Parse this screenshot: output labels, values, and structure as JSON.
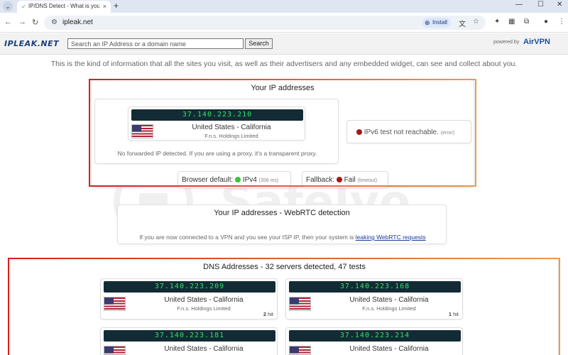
{
  "browser": {
    "tab_title": "IP/DNS Detect - What is your IP",
    "tab_close": "×",
    "new_tab": "+",
    "chevron": "⌄",
    "minimize": "—",
    "maximize": "☐",
    "close": "✕",
    "url": "ipleak.net",
    "install_label": "Install"
  },
  "site": {
    "logo": "IPLEAK.NET",
    "search_placeholder": "Search an IP Address or a domain name",
    "search_button": "Search",
    "powered_by": "powered by",
    "airvpn": "AirVPN",
    "intro": "This is the kind of information that all the sites you visit, as well as their advertisers and any embedded widget, can see and collect about you."
  },
  "ip_section": {
    "title": "Your IP addresses",
    "ip": "37.140.223.210",
    "location": "United States - California",
    "isp": "F.n.s. Holdings Limited",
    "forward_note": "No forwarded IP detected. If you are using a proxy, it's a transparent proxy.",
    "ipv6_text": "IPv6 test not reachable.",
    "ipv6_error": "(error)",
    "browser_default_label": "Browser default:",
    "browser_default_value": "IPv4",
    "browser_default_time": "(356 ms)",
    "fallback_label": "Fallback:",
    "fallback_value": "Fail",
    "fallback_note": "(timeout)"
  },
  "webrtc": {
    "title": "Your IP addresses - WebRTC detection",
    "note": "If you are now connected to a VPN and you see your ISP IP, then your system is",
    "link": "leaking WebRTC requests"
  },
  "dns": {
    "title": "DNS Addresses - 32 servers detected, 47 tests",
    "servers": [
      {
        "ip": "37.140.223.209",
        "location": "United States - California",
        "isp": "F.n.s. Holdings Limited",
        "hits_num": "2",
        "hits_unit": "hit"
      },
      {
        "ip": "37.140.223.168",
        "location": "United States - California",
        "isp": "F.n.s. Holdings Limited",
        "hits_num": "1",
        "hits_unit": "hit"
      },
      {
        "ip": "37.140.223.181",
        "location": "United States - California",
        "isp": "",
        "hits_num": "",
        "hits_unit": ""
      },
      {
        "ip": "37.140.223.214",
        "location": "United States - California",
        "isp": "",
        "hits_num": "",
        "hits_unit": ""
      }
    ]
  },
  "watermark": {
    "text": "Safelyo"
  },
  "colors": {
    "ip_bar_bg": "#122b34",
    "ip_text": "#36e06a",
    "highlight_start": "#d62020",
    "highlight_end": "#ee9a4a",
    "status_ok": "#3ac43a",
    "status_fail": "#a31818"
  }
}
